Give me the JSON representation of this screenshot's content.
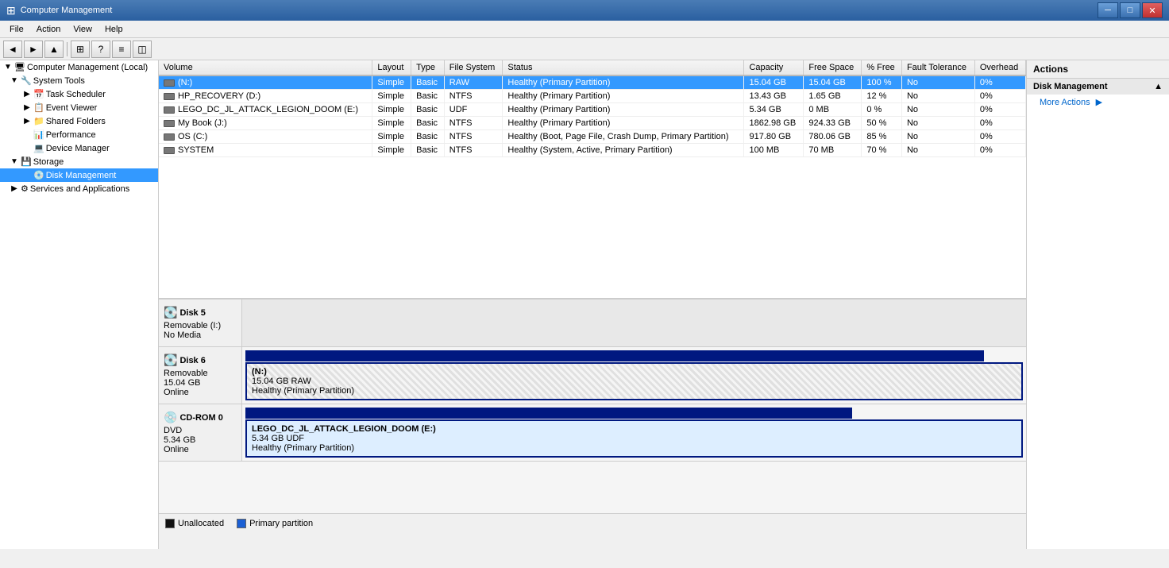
{
  "window": {
    "title": "Computer Management",
    "icon": "⊞"
  },
  "menu": {
    "items": [
      "File",
      "Action",
      "View",
      "Help"
    ]
  },
  "toolbar": {
    "buttons": [
      "←",
      "→",
      "↑",
      "⊞",
      "?",
      "≡",
      "◫"
    ]
  },
  "sidebar": {
    "root": "Computer Management (Local)",
    "items": [
      {
        "id": "system-tools",
        "label": "System Tools",
        "level": 1,
        "expanded": true,
        "icon": "🔧"
      },
      {
        "id": "task-scheduler",
        "label": "Task Scheduler",
        "level": 2,
        "icon": "📅"
      },
      {
        "id": "event-viewer",
        "label": "Event Viewer",
        "level": 2,
        "icon": "📋"
      },
      {
        "id": "shared-folders",
        "label": "Shared Folders",
        "level": 2,
        "icon": "📁"
      },
      {
        "id": "performance",
        "label": "Performance",
        "level": 2,
        "icon": "📊"
      },
      {
        "id": "device-manager",
        "label": "Device Manager",
        "level": 2,
        "icon": "💻"
      },
      {
        "id": "storage",
        "label": "Storage",
        "level": 1,
        "expanded": true,
        "icon": "💾"
      },
      {
        "id": "disk-management",
        "label": "Disk Management",
        "level": 2,
        "icon": "💿",
        "selected": true
      },
      {
        "id": "services",
        "label": "Services and Applications",
        "level": 1,
        "expanded": false,
        "icon": "⚙"
      }
    ]
  },
  "table": {
    "columns": [
      "Volume",
      "Layout",
      "Type",
      "File System",
      "Status",
      "Capacity",
      "Free Space",
      "% Free",
      "Fault Tolerance",
      "Overhead"
    ],
    "rows": [
      {
        "volume": "(N:)",
        "layout": "Simple",
        "type": "Basic",
        "fs": "RAW",
        "status": "Healthy (Primary Partition)",
        "capacity": "15.04 GB",
        "free": "15.04 GB",
        "pct": "100 %",
        "ft": "No",
        "overhead": "0%",
        "selected": true
      },
      {
        "volume": "HP_RECOVERY (D:)",
        "layout": "Simple",
        "type": "Basic",
        "fs": "NTFS",
        "status": "Healthy (Primary Partition)",
        "capacity": "13.43 GB",
        "free": "1.65 GB",
        "pct": "12 %",
        "ft": "No",
        "overhead": "0%"
      },
      {
        "volume": "LEGO_DC_JL_ATTACK_LEGION_DOOM (E:)",
        "layout": "Simple",
        "type": "Basic",
        "fs": "UDF",
        "status": "Healthy (Primary Partition)",
        "capacity": "5.34 GB",
        "free": "0 MB",
        "pct": "0 %",
        "ft": "No",
        "overhead": "0%"
      },
      {
        "volume": "My Book (J:)",
        "layout": "Simple",
        "type": "Basic",
        "fs": "NTFS",
        "status": "Healthy (Primary Partition)",
        "capacity": "1862.98 GB",
        "free": "924.33 GB",
        "pct": "50 %",
        "ft": "No",
        "overhead": "0%"
      },
      {
        "volume": "OS (C:)",
        "layout": "Simple",
        "type": "Basic",
        "fs": "NTFS",
        "status": "Healthy (Boot, Page File, Crash Dump, Primary Partition)",
        "capacity": "917.80 GB",
        "free": "780.06 GB",
        "pct": "85 %",
        "ft": "No",
        "overhead": "0%"
      },
      {
        "volume": "SYSTEM",
        "layout": "Simple",
        "type": "Basic",
        "fs": "NTFS",
        "status": "Healthy (System, Active, Primary Partition)",
        "capacity": "100 MB",
        "free": "70 MB",
        "pct": "70 %",
        "ft": "No",
        "overhead": "0%"
      }
    ]
  },
  "diskView": {
    "disk5": {
      "name": "Disk 5",
      "type": "Removable (I:)",
      "size": "",
      "status": "No Media",
      "partition": null
    },
    "disk6": {
      "name": "Disk 6",
      "type": "Removable",
      "size": "15.04 GB",
      "status": "Online",
      "partition": {
        "name": "(N:)",
        "size": "15.04 GB RAW",
        "status": "Healthy (Primary Partition)"
      }
    },
    "cdrom0": {
      "name": "CD-ROM 0",
      "type": "DVD",
      "size": "5.34 GB",
      "status": "Online",
      "partition": {
        "name": "LEGO_DC_JL_ATTACK_LEGION_DOOM (E:)",
        "size": "5.34 GB UDF",
        "status": "Healthy (Primary Partition)"
      }
    }
  },
  "legend": {
    "unallocated": "Unallocated",
    "primary": "Primary partition"
  },
  "actions": {
    "header": "Actions",
    "section": "Disk Management",
    "items": [
      "More Actions"
    ]
  }
}
